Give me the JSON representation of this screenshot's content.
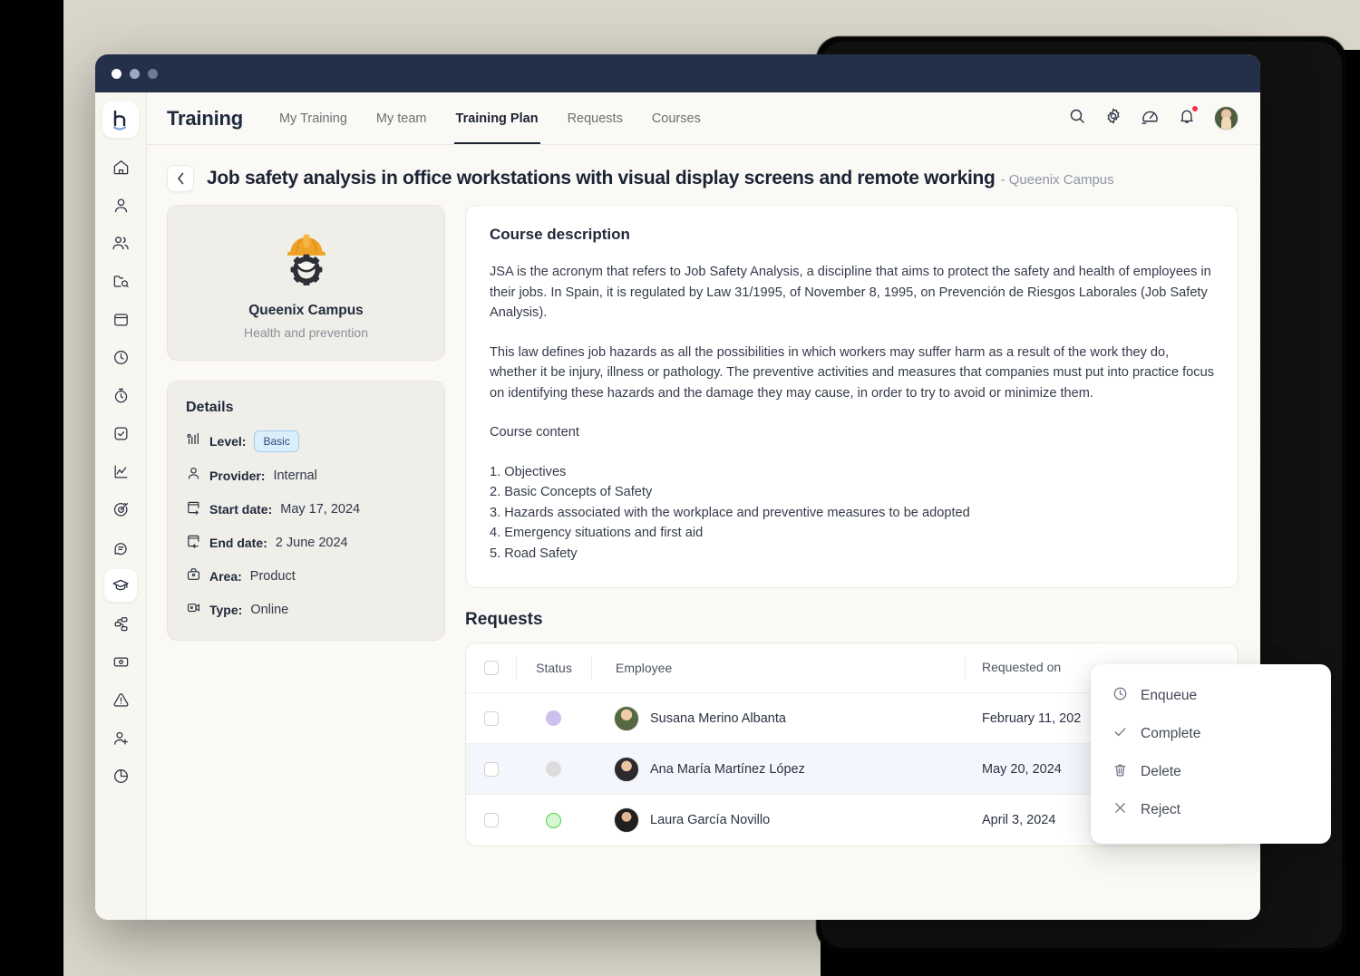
{
  "window": {
    "traffic_lights": [
      "close",
      "minimize",
      "maximize"
    ]
  },
  "topnav": {
    "brand": "Training",
    "tabs": [
      {
        "label": "My Training",
        "active": false
      },
      {
        "label": "My team",
        "active": false
      },
      {
        "label": "Training Plan",
        "active": true
      },
      {
        "label": "Requests",
        "active": false
      },
      {
        "label": "Courses",
        "active": false
      }
    ],
    "icons": [
      {
        "name": "search-icon"
      },
      {
        "name": "gear-icon"
      },
      {
        "name": "speedometer-icon"
      },
      {
        "name": "bell-icon",
        "has_notification": true
      },
      {
        "name": "avatar"
      }
    ]
  },
  "sidebar": {
    "logo": "h",
    "items": [
      {
        "name": "home-icon",
        "active": false
      },
      {
        "name": "user-icon",
        "active": false
      },
      {
        "name": "users-icon",
        "active": false
      },
      {
        "name": "folder-search-icon",
        "active": false
      },
      {
        "name": "calendar-icon",
        "active": false
      },
      {
        "name": "clock-icon",
        "active": false
      },
      {
        "name": "timer-icon",
        "active": false
      },
      {
        "name": "checkbox-icon",
        "active": false
      },
      {
        "name": "chart-line-icon",
        "active": false
      },
      {
        "name": "target-icon",
        "active": false
      },
      {
        "name": "chat-icon",
        "active": false
      },
      {
        "name": "graduation-cap-icon",
        "active": true
      },
      {
        "name": "workflow-icon",
        "active": false
      },
      {
        "name": "money-icon",
        "active": false
      },
      {
        "name": "alert-triangle-icon",
        "active": false
      },
      {
        "name": "user-plus-icon",
        "active": false
      },
      {
        "name": "pie-chart-icon",
        "active": false
      }
    ]
  },
  "page": {
    "back_label": "‹",
    "title": "Job safety analysis in office workstations with visual display screens and remote working",
    "subtitle": "- Queenix Campus"
  },
  "course_card": {
    "icon": "hard-hat-gear-icon",
    "name": "Queenix Campus",
    "category": "Health and prevention"
  },
  "details": {
    "title": "Details",
    "rows": [
      {
        "icon": "signal-level-icon",
        "label": "Level:",
        "value": "Basic",
        "is_pill": true
      },
      {
        "icon": "user-icon",
        "label": "Provider:",
        "value": "Internal",
        "is_pill": false
      },
      {
        "icon": "calendar-start-icon",
        "label": "Start date:",
        "value": "May 17, 2024",
        "is_pill": false
      },
      {
        "icon": "calendar-end-icon",
        "label": "End date:",
        "value": "2 June 2024",
        "is_pill": false
      },
      {
        "icon": "briefcase-icon",
        "label": "Area:",
        "value": "Product",
        "is_pill": false
      },
      {
        "icon": "video-camera-icon",
        "label": "Type:",
        "value": "Online",
        "is_pill": false
      }
    ]
  },
  "description": {
    "title": "Course description",
    "paragraphs": [
      "JSA is the acronym that refers to Job Safety Analysis, a discipline that aims to protect the safety and health of employees in their jobs. In Spain, it is regulated by Law 31/1995, of November 8, 1995, on Prevención de Riesgos Laborales (Job Safety Analysis).",
      "This law defines job hazards as all the possibilities in which workers may suffer harm as a result of the work they do, whether it be injury, illness or pathology. The preventive activities and measures that companies must put into practice focus on identifying these hazards and the damage they may cause, in order to try to avoid or minimize them."
    ],
    "content_heading": "Course content",
    "content_items": [
      "1. Objectives",
      "2. Basic Concepts of Safety",
      "3. Hazards associated with the workplace and preventive measures to be adopted",
      "4. Emergency situations and first aid",
      "5. Road Safety"
    ]
  },
  "requests": {
    "title": "Requests",
    "columns": [
      "Status",
      "Employee",
      "Requested on"
    ],
    "rows": [
      {
        "checked": false,
        "status_color": "#cdc0f0",
        "status_style": "filled",
        "employee": "Susana Merino Albanta",
        "requested_on": "February 11, 202",
        "selected": false
      },
      {
        "checked": false,
        "status_color": "#dcdcdc",
        "status_style": "filled",
        "employee": "Ana María Martínez López",
        "requested_on": "May 20, 2024",
        "selected": true
      },
      {
        "checked": false,
        "status_color": "#c8f7c5",
        "status_style": "outlined",
        "employee": "Laura García Novillo",
        "requested_on": "April 3, 2024",
        "selected": false
      }
    ]
  },
  "context_menu": {
    "items": [
      {
        "icon": "clock-icon",
        "label": "Enqueue"
      },
      {
        "icon": "check-icon",
        "label": "Complete"
      },
      {
        "icon": "trash-icon",
        "label": "Delete"
      },
      {
        "icon": "x-icon",
        "label": "Reject"
      }
    ]
  },
  "colors": {
    "backdrop": "#d9d5c9",
    "titlebar": "#24304a",
    "app_bg": "#faf9f5",
    "accent_pill_bg": "#dbeefc",
    "accent_pill_border": "#9ccef0",
    "notification": "#f4354a",
    "selected_row": "#f3f6fd",
    "helmet": "#f0a227"
  }
}
